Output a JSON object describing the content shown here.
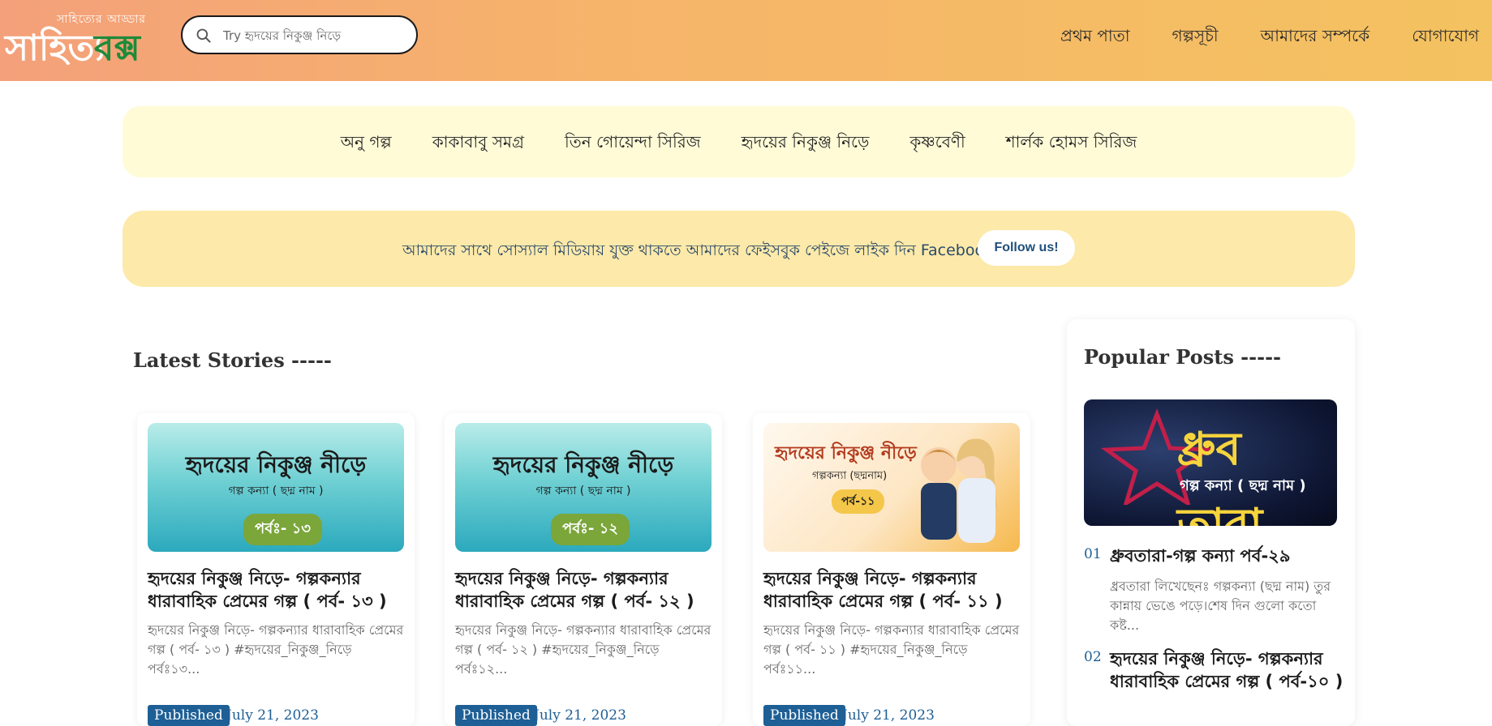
{
  "header": {
    "logo_tagline": "সাহিত্যের আড্ডার",
    "logo_part1": "সাহিত্য",
    "logo_part2": "বক্স",
    "search_placeholder": "Try হৃদয়ের নিকুঞ্জ নিড়ে",
    "nav": [
      "প্রথম পাতা",
      "গল্পসূচী",
      "আমাদের সম্পর্কে",
      "যোগাযোগ"
    ]
  },
  "categories": [
    "অনু গল্প",
    "কাকাবাবু সমগ্র",
    "তিন গোয়েন্দা সিরিজ",
    "হৃদয়ের নিকুঞ্জ নিড়ে",
    "কৃষ্ণবেণী",
    "শার্লক হোমস সিরিজ"
  ],
  "follow": {
    "text": "আমাদের সাথে সোস্যাল মিডিয়ায় যুক্ত থাকতে আমাদের ফেইসবুক পেইজে লাইক দিন  Facebook",
    "button": "Follow us!"
  },
  "latest": {
    "heading": "Latest Stories -----",
    "cards": [
      {
        "thumb_title": "হৃদয়ের নিকুঞ্জ নীড়ে",
        "thumb_sub": "গল্প কন্যা ( ছদ্ম নাম )",
        "thumb_part": "পর্বঃ- ১৩",
        "title": "হৃদয়ের নিকুঞ্জ নিড়ে- গল্পকন্যার ধারাবাহিক প্রেমের গল্প ( পর্ব- ১৩ )",
        "excerpt": "হৃদয়ের নিকুঞ্জ নিড়ে- গল্পকন্যার ধারাবাহিক প্রেমের গল্প ( পর্ব- ১৩ ) #হৃদয়ের_নিকুঞ্জ_নিড়ে পর্বঃ১৩...",
        "badge": "Published",
        "date": "July 21, 2023"
      },
      {
        "thumb_title": "হৃদয়ের নিকুঞ্জ নীড়ে",
        "thumb_sub": "গল্প কন্যা ( ছদ্ম নাম )",
        "thumb_part": "পর্বঃ- ১২",
        "title": "হৃদয়ের নিকুঞ্জ নিড়ে- গল্পকন্যার ধারাবাহিক প্রেমের গল্প ( পর্ব- ১২ )",
        "excerpt": "হৃদয়ের নিকুঞ্জ নিড়ে- গল্পকন্যার ধারাবাহিক প্রেমের গল্প ( পর্ব- ১২ ) #হৃদয়ের_নিকুঞ্জ_নিড়ে পর্বঃ১২...",
        "badge": "Published",
        "date": "July 21, 2023"
      },
      {
        "thumb_title": "হৃদয়ের নিকুঞ্জ নীড়ে",
        "thumb_sub": "গল্পকন্যা (ছদ্মনাম)",
        "thumb_part": "পর্ব-১১",
        "title": "হৃদয়ের নিকুঞ্জ নিড়ে- গল্পকন্যার ধারাবাহিক প্রেমের গল্প ( পর্ব- ১১ )",
        "excerpt": "হৃদয়ের নিকুঞ্জ নিড়ে- গল্পকন্যার ধারাবাহিক প্রেমের গল্প ( পর্ব- ১১ ) #হৃদয়ের_নিকুঞ্জ_নিড়ে পর্বঃ১১...",
        "badge": "Published",
        "date": "July 21, 2023"
      }
    ]
  },
  "popular": {
    "heading": "Popular Posts -----",
    "banner_title": "ধ্রুব তারা",
    "banner_sub": "গল্প কন্যা ( ছদ্ম নাম )",
    "items": [
      {
        "num": "01",
        "title": "ধ্রুবতারা-গল্প কন্যা পর্ব-২৯",
        "excerpt": "ধ্রবতারা লিখেছেনঃ গল্পকন্যা (ছদ্ম নাম) তুর কান্নায় ভেঙে পড়ে।শেষ দিন গুলো কতো কষ্ট..."
      },
      {
        "num": "02",
        "title": "হৃদয়ের নিকুঞ্জ নিড়ে- গল্পকন্যার ধারাবাহিক প্রেমের গল্প ( পর্ব-১০ )"
      }
    ]
  },
  "colors": {
    "header_start": "#f4a07a",
    "header_end": "#f4c260",
    "category_bg": "#fffbd7",
    "follow_bg": "#fde9a9",
    "badge_bg": "#1e5f95"
  }
}
